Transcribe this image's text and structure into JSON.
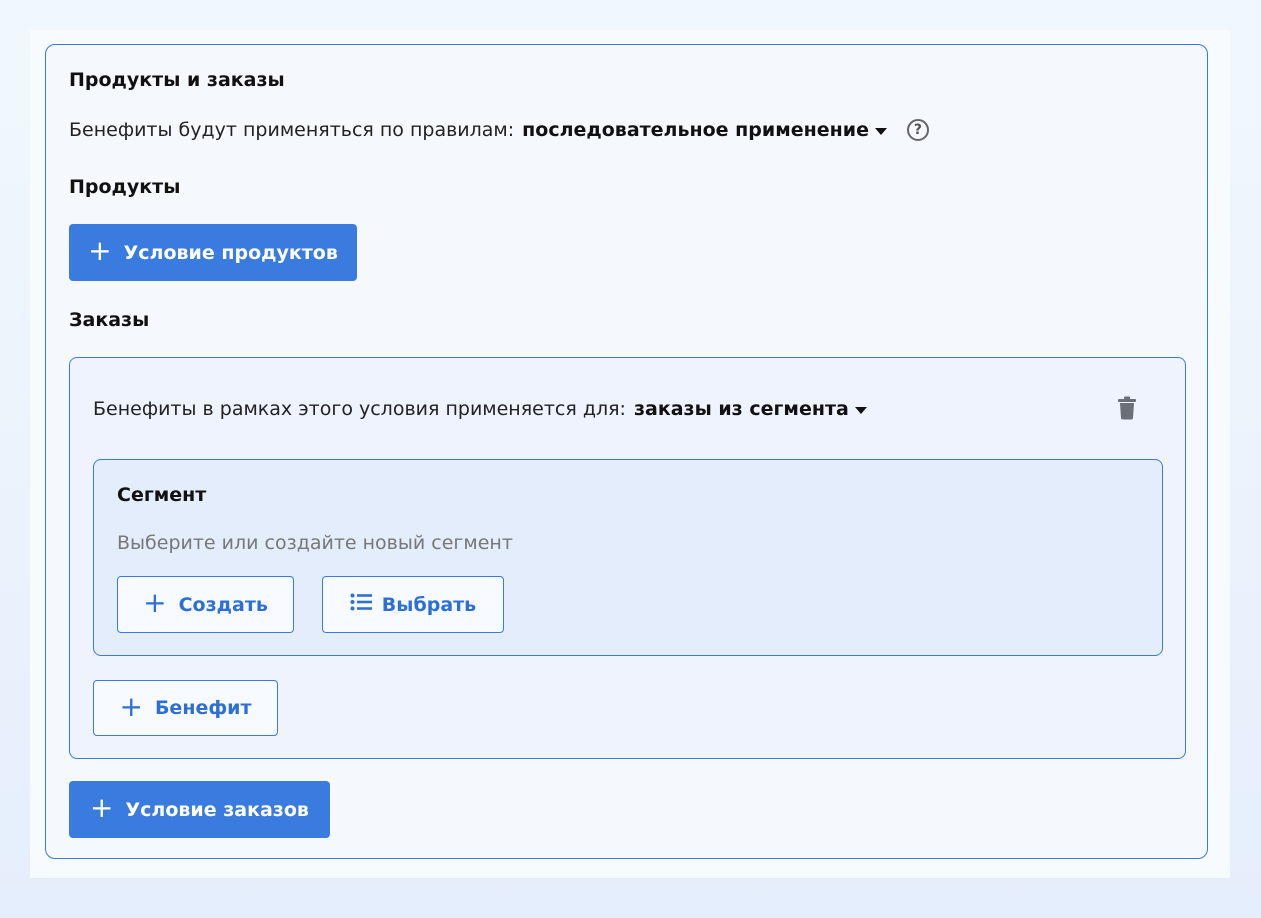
{
  "section": {
    "title": "Продукты и заказы",
    "rule_label": "Бенефиты будут применяться по правилам:",
    "rule_value": "последовательное применение",
    "help_symbol": "?"
  },
  "products": {
    "title": "Продукты",
    "add_condition_label": "Условие продуктов"
  },
  "orders": {
    "title": "Заказы",
    "condition": {
      "apply_label": "Бенефиты в рамках этого условия применяется для:",
      "apply_value": "заказы из сегмента",
      "segment": {
        "title": "Сегмент",
        "placeholder": "Выберите или создайте новый сегмент",
        "create_label": "Создать",
        "select_label": "Выбрать"
      },
      "add_benefit_label": "Бенефит"
    },
    "add_condition_label": "Условие заказов"
  },
  "icons": {
    "plus": "plus-icon",
    "help": "question-circle-icon",
    "trash": "trash-icon",
    "list": "list-icon",
    "caret": "caret-down-icon"
  },
  "colors": {
    "accent": "#3a7be0",
    "border": "#3d7ad6"
  }
}
